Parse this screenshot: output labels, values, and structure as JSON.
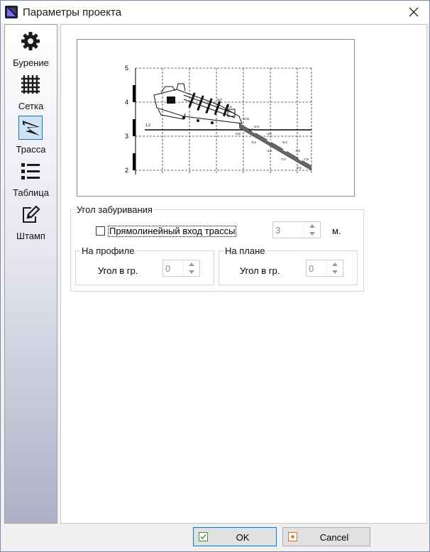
{
  "window": {
    "title": "Параметры проекта"
  },
  "sidebar": {
    "items": [
      {
        "label": "Бурение",
        "icon": "gear-icon"
      },
      {
        "label": "Сетка",
        "icon": "grid-icon"
      },
      {
        "label": "Трасса",
        "icon": "route-icon",
        "selected": true
      },
      {
        "label": "Таблица",
        "icon": "list-icon"
      },
      {
        "label": "Штамп",
        "icon": "stamp-edit-icon"
      }
    ]
  },
  "preview": {
    "y_ticks": [
      "5",
      "4",
      "3",
      "2"
    ],
    "annotations": [
      "1,2",
      "-0,01",
      "-0,8",
      "-1,0",
      "-2,9",
      "-3,4",
      "-4,6",
      "-4,9",
      "-6,4",
      "-7,0",
      "-7,3",
      "-7,5",
      "-7,8",
      "-8,0",
      "-8,2"
    ]
  },
  "entry_angle": {
    "legend": "Угол забуривания",
    "straight_entry_label": "Прямолинейный вход трассы",
    "straight_entry_checked": false,
    "length_value": "3",
    "length_unit": "м."
  },
  "profile": {
    "legend": "На профиле",
    "angle_label": "Угол в гр.",
    "angle_value": "0"
  },
  "plan": {
    "legend": "На плане",
    "angle_label": "Угол в гр.",
    "angle_value": "0"
  },
  "buttons": {
    "ok": "OK",
    "cancel": "Cancel"
  },
  "colors": {
    "accent": "#0078d7",
    "selection": "#cfe3f7",
    "ok_icon": "#3a9a3a",
    "cancel_icon": "#e06a1a"
  }
}
